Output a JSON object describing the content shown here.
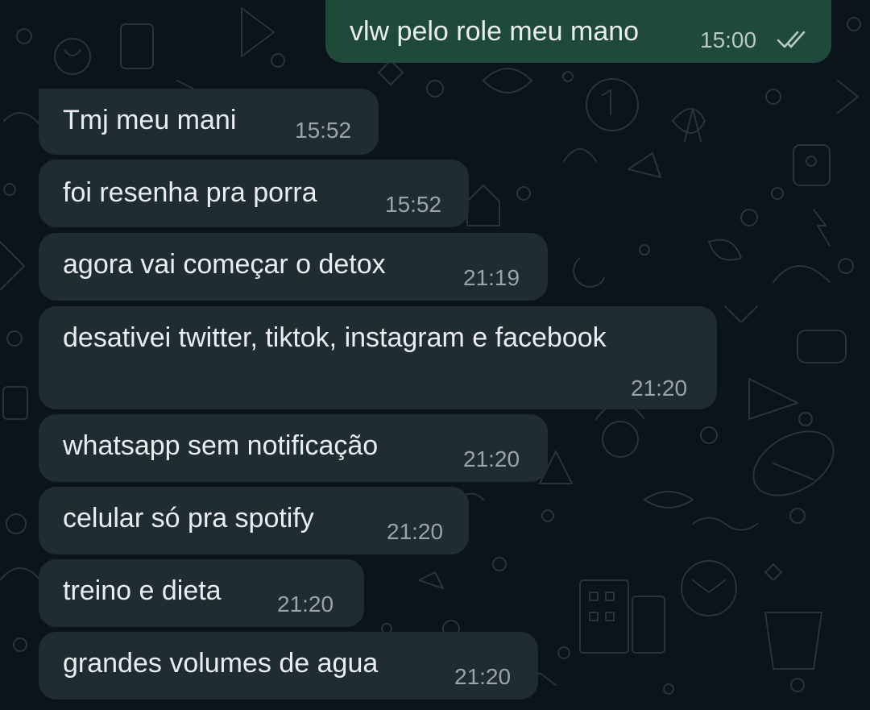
{
  "theme": {
    "background": "#0b141a",
    "incoming_bubble": "#202c33",
    "outgoing_bubble": "#1f4a3a",
    "text": "#e9edef",
    "timestamp": "#9aa3a8",
    "read_ticks": "#b7c9c1"
  },
  "messages": [
    {
      "direction": "outgoing",
      "text": "vlw pelo role meu mano",
      "time": "15:00",
      "status": "read",
      "status_icon": "double-check-icon"
    },
    {
      "direction": "incoming",
      "text": "Tmj meu mani",
      "time": "15:52"
    },
    {
      "direction": "incoming",
      "text": "foi resenha pra porra",
      "time": "15:52"
    },
    {
      "direction": "incoming",
      "text": "agora vai começar o detox",
      "time": "21:19"
    },
    {
      "direction": "incoming",
      "text": "desativei twitter, tiktok, instagram e facebook",
      "time": "21:20"
    },
    {
      "direction": "incoming",
      "text": "whatsapp sem notificação",
      "time": "21:20"
    },
    {
      "direction": "incoming",
      "text": "celular só pra spotify",
      "time": "21:20"
    },
    {
      "direction": "incoming",
      "text": "treino e dieta",
      "time": "21:20"
    },
    {
      "direction": "incoming",
      "text": "grandes volumes de agua",
      "time": "21:20"
    }
  ]
}
